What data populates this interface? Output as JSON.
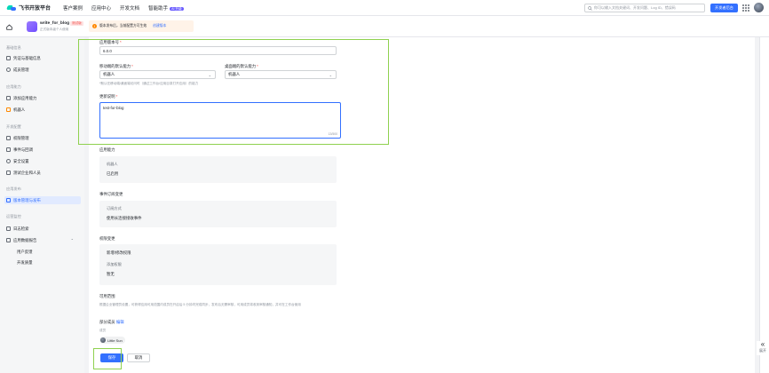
{
  "topbar": {
    "brand": "飞书开放平台",
    "nav": [
      "客户案例",
      "应用中心",
      "开发文档",
      "智能助手"
    ],
    "ai_badge": "AI 升级",
    "search_placeholder": "你可以输入文档关键词、开发问题、Log ID、错误码",
    "dev_console": "开发者后台"
  },
  "app": {
    "name": "write_for_blog",
    "tag": "测试版",
    "desc": "正式版本级个人使用",
    "notice": "版本发布后，当前配置方可生效",
    "notice_link": "创建版本"
  },
  "sidebar": {
    "sec_basic": "基础信息",
    "item_credentials": "凭证与基础信息",
    "item_members": "成员管理",
    "sec_ability": "应用能力",
    "item_add_ability": "添加应用能力",
    "item_bot": "机器人",
    "sec_dev": "开发配置",
    "item_permissions": "权限管理",
    "item_events": "事件与回调",
    "item_security": "安全设置",
    "item_test_company": "测试企业和人员",
    "sec_release": "应用发布",
    "item_version": "版本管理与发布",
    "sec_ops": "运营监控",
    "item_logs": "日志检索",
    "item_data": "应用数据报告",
    "sub_users": "用户反馈",
    "sub_open": "开发质量"
  },
  "form": {
    "version_label": "应用版本号",
    "version_value": "6.0.0",
    "mobile_label": "移动端的默认能力",
    "mobile_value": "机器人",
    "desktop_label": "桌面端的默认能力",
    "desktop_value": "机器人",
    "hint": "*默认在移动端/桌面端访问时（通过工作台/应用目录打开应用）的能力",
    "notes_label": "更新说明",
    "notes_value": "test-for-blog",
    "notes_counter": "13/500"
  },
  "summary": {
    "ability_title": "应用能力",
    "ability_name": "机器人",
    "ability_status": "已启用",
    "event_title": "事件订阅变更",
    "event_mode_label": "订阅方式",
    "event_mode_value": "使用长连接接收事件",
    "perm_title": "权限变更",
    "perm_new_label": "新增/修改权限",
    "perm_new_value": "",
    "perm_add_label": "添加权限",
    "perm_add_value": "暂无",
    "scope_title": "可用范围",
    "scope_desc": "根据企业管理员设置，可获得应用可用范围内成员在开启后 5 分钟内完成同步，发布后无需审核，可用成员将收到审核通知，并可在工作台使用",
    "scope_partial": "部分成员",
    "scope_edit": "编辑",
    "scope_members_label": "成员",
    "member_name": "Little Sun"
  },
  "actions": {
    "save": "保存",
    "cancel": "取消"
  },
  "rail": {
    "collapse_label": "展开"
  },
  "colors": {
    "accent": "#3370ff",
    "highlight": "#8fd14f"
  }
}
